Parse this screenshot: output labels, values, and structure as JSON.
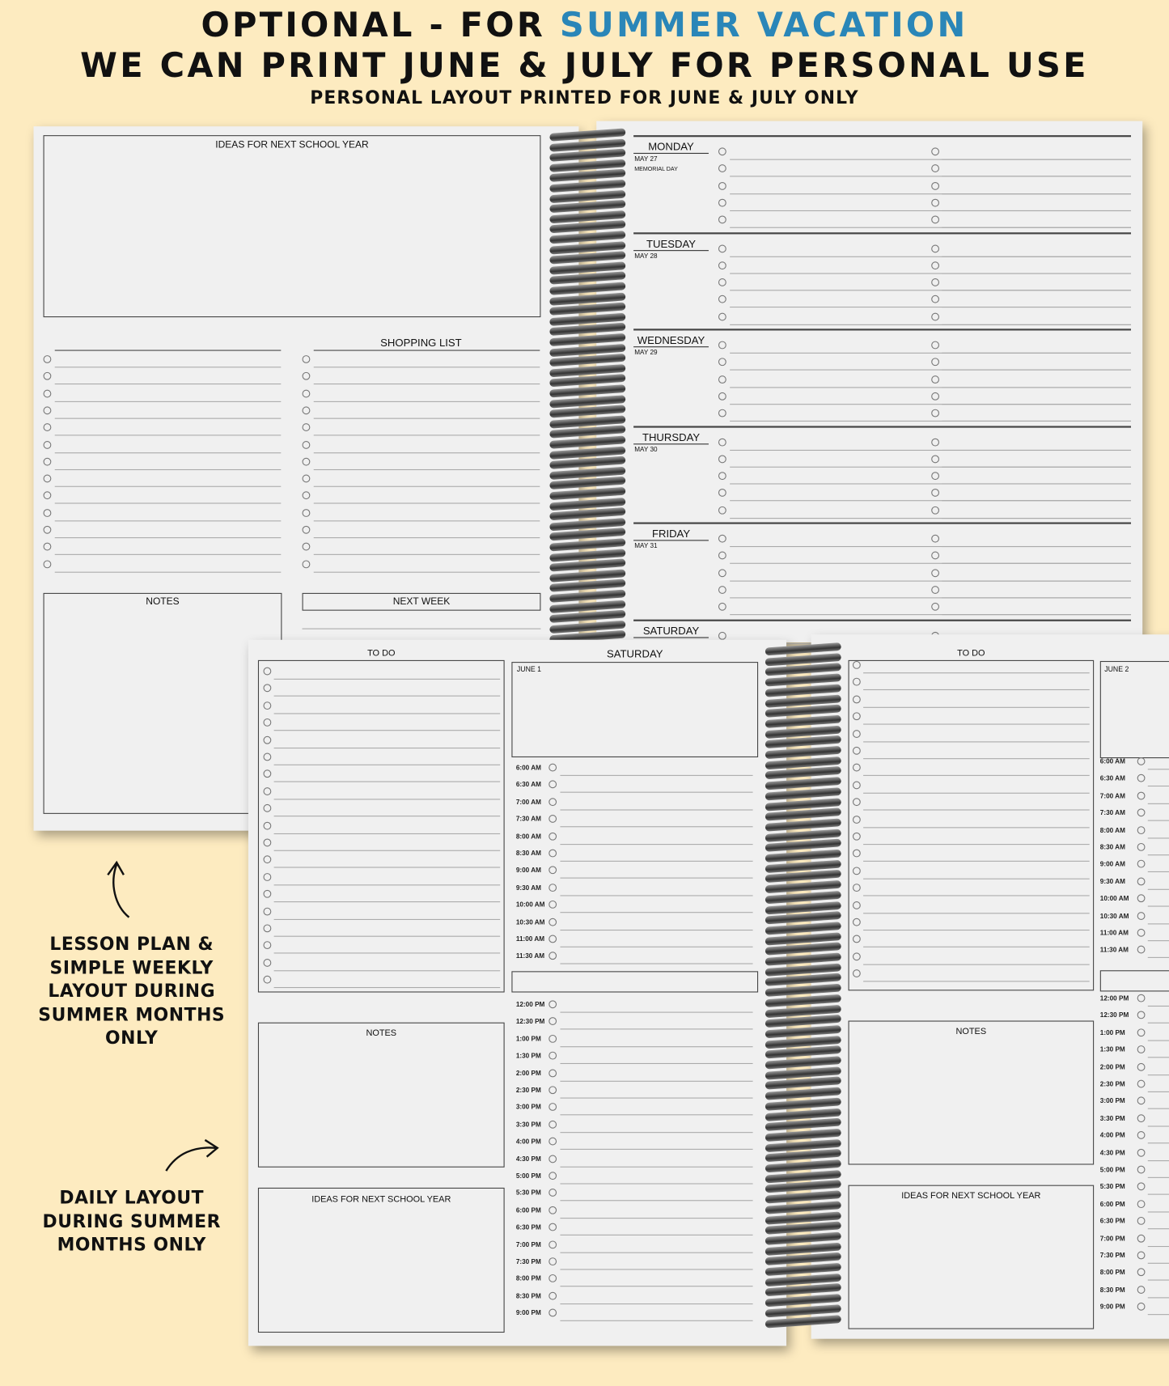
{
  "headline": {
    "line1_prefix": "OPTIONAL - FOR ",
    "line1_accent": "SUMMER VACATION",
    "line2": "WE CAN PRINT JUNE & JULY FOR PERSONAL USE",
    "line3": "PERSONAL LAYOUT PRINTED FOR JUNE & JULY ONLY",
    "accent_color": "#2a86b8"
  },
  "back_left": {
    "ideas": "IDEAS FOR NEXT SCHOOL YEAR",
    "shopping": "SHOPPING LIST",
    "notes": "NOTES",
    "next_week": "NEXT WEEK"
  },
  "back_right": {
    "days": [
      {
        "day": "MONDAY",
        "date": "MAY 27",
        "note": "MEMORIAL DAY"
      },
      {
        "day": "TUESDAY",
        "date": "MAY 28"
      },
      {
        "day": "WEDNESDAY",
        "date": "MAY 29"
      },
      {
        "day": "THURSDAY",
        "date": "MAY 30"
      },
      {
        "day": "FRIDAY",
        "date": "MAY 31"
      },
      {
        "day": "SATURDAY"
      }
    ]
  },
  "front_left": {
    "todo": "TO DO",
    "day": "SATURDAY",
    "date": "JUNE 1",
    "notes": "NOTES",
    "ideas": "IDEAS FOR NEXT SCHOOL YEAR"
  },
  "front_right": {
    "todo": "TO DO",
    "date": "JUNE 2",
    "notes": "NOTES",
    "ideas": "IDEAS FOR NEXT SCHOOL YEAR"
  },
  "times_am": [
    "6:00 AM",
    "6:30 AM",
    "7:00 AM",
    "7:30 AM",
    "8:00 AM",
    "8:30 AM",
    "9:00 AM",
    "9:30 AM",
    "10:00 AM",
    "10:30 AM",
    "11:00 AM",
    "11:30 AM"
  ],
  "times_pm": [
    "12:00 PM",
    "12:30 PM",
    "1:00 PM",
    "1:30 PM",
    "2:00 PM",
    "2:30 PM",
    "3:00 PM",
    "3:30 PM",
    "4:00 PM",
    "4:30 PM",
    "5:00 PM",
    "5:30 PM",
    "6:00 PM",
    "6:30 PM",
    "7:00 PM",
    "7:30 PM",
    "8:00 PM",
    "8:30 PM",
    "9:00 PM"
  ],
  "captions": {
    "lesson": "LESSON PLAN & SIMPLE WEEKLY LAYOUT DURING SUMMER MONTHS ONLY",
    "daily": "DAILY LAYOUT DURING SUMMER MONTHS ONLY"
  }
}
